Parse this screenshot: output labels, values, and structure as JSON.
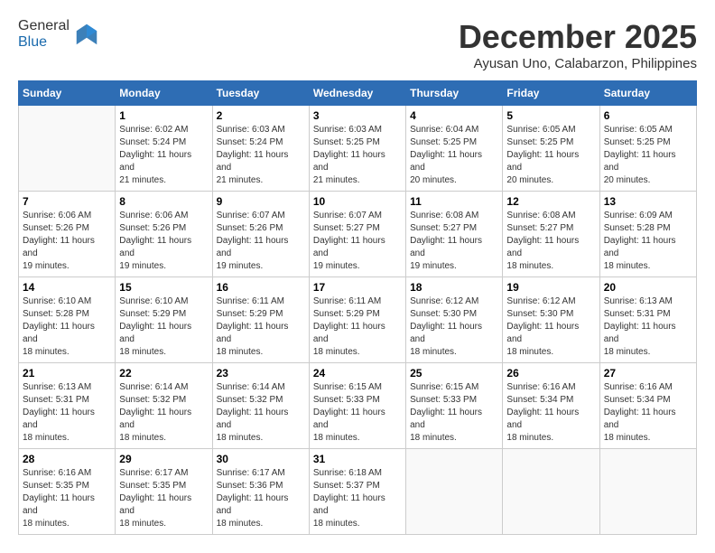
{
  "logo": {
    "general": "General",
    "blue": "Blue"
  },
  "header": {
    "month": "December 2025",
    "location": "Ayusan Uno, Calabarzon, Philippines"
  },
  "weekdays": [
    "Sunday",
    "Monday",
    "Tuesday",
    "Wednesday",
    "Thursday",
    "Friday",
    "Saturday"
  ],
  "weeks": [
    [
      {
        "day": "",
        "empty": true
      },
      {
        "day": "1",
        "sunrise": "6:02 AM",
        "sunset": "5:24 PM",
        "daylight": "11 hours and 21 minutes."
      },
      {
        "day": "2",
        "sunrise": "6:03 AM",
        "sunset": "5:24 PM",
        "daylight": "11 hours and 21 minutes."
      },
      {
        "day": "3",
        "sunrise": "6:03 AM",
        "sunset": "5:25 PM",
        "daylight": "11 hours and 21 minutes."
      },
      {
        "day": "4",
        "sunrise": "6:04 AM",
        "sunset": "5:25 PM",
        "daylight": "11 hours and 20 minutes."
      },
      {
        "day": "5",
        "sunrise": "6:05 AM",
        "sunset": "5:25 PM",
        "daylight": "11 hours and 20 minutes."
      },
      {
        "day": "6",
        "sunrise": "6:05 AM",
        "sunset": "5:25 PM",
        "daylight": "11 hours and 20 minutes."
      }
    ],
    [
      {
        "day": "7",
        "sunrise": "6:06 AM",
        "sunset": "5:26 PM",
        "daylight": "11 hours and 19 minutes."
      },
      {
        "day": "8",
        "sunrise": "6:06 AM",
        "sunset": "5:26 PM",
        "daylight": "11 hours and 19 minutes."
      },
      {
        "day": "9",
        "sunrise": "6:07 AM",
        "sunset": "5:26 PM",
        "daylight": "11 hours and 19 minutes."
      },
      {
        "day": "10",
        "sunrise": "6:07 AM",
        "sunset": "5:27 PM",
        "daylight": "11 hours and 19 minutes."
      },
      {
        "day": "11",
        "sunrise": "6:08 AM",
        "sunset": "5:27 PM",
        "daylight": "11 hours and 19 minutes."
      },
      {
        "day": "12",
        "sunrise": "6:08 AM",
        "sunset": "5:27 PM",
        "daylight": "11 hours and 18 minutes."
      },
      {
        "day": "13",
        "sunrise": "6:09 AM",
        "sunset": "5:28 PM",
        "daylight": "11 hours and 18 minutes."
      }
    ],
    [
      {
        "day": "14",
        "sunrise": "6:10 AM",
        "sunset": "5:28 PM",
        "daylight": "11 hours and 18 minutes."
      },
      {
        "day": "15",
        "sunrise": "6:10 AM",
        "sunset": "5:29 PM",
        "daylight": "11 hours and 18 minutes."
      },
      {
        "day": "16",
        "sunrise": "6:11 AM",
        "sunset": "5:29 PM",
        "daylight": "11 hours and 18 minutes."
      },
      {
        "day": "17",
        "sunrise": "6:11 AM",
        "sunset": "5:29 PM",
        "daylight": "11 hours and 18 minutes."
      },
      {
        "day": "18",
        "sunrise": "6:12 AM",
        "sunset": "5:30 PM",
        "daylight": "11 hours and 18 minutes."
      },
      {
        "day": "19",
        "sunrise": "6:12 AM",
        "sunset": "5:30 PM",
        "daylight": "11 hours and 18 minutes."
      },
      {
        "day": "20",
        "sunrise": "6:13 AM",
        "sunset": "5:31 PM",
        "daylight": "11 hours and 18 minutes."
      }
    ],
    [
      {
        "day": "21",
        "sunrise": "6:13 AM",
        "sunset": "5:31 PM",
        "daylight": "11 hours and 18 minutes."
      },
      {
        "day": "22",
        "sunrise": "6:14 AM",
        "sunset": "5:32 PM",
        "daylight": "11 hours and 18 minutes."
      },
      {
        "day": "23",
        "sunrise": "6:14 AM",
        "sunset": "5:32 PM",
        "daylight": "11 hours and 18 minutes."
      },
      {
        "day": "24",
        "sunrise": "6:15 AM",
        "sunset": "5:33 PM",
        "daylight": "11 hours and 18 minutes."
      },
      {
        "day": "25",
        "sunrise": "6:15 AM",
        "sunset": "5:33 PM",
        "daylight": "11 hours and 18 minutes."
      },
      {
        "day": "26",
        "sunrise": "6:16 AM",
        "sunset": "5:34 PM",
        "daylight": "11 hours and 18 minutes."
      },
      {
        "day": "27",
        "sunrise": "6:16 AM",
        "sunset": "5:34 PM",
        "daylight": "11 hours and 18 minutes."
      }
    ],
    [
      {
        "day": "28",
        "sunrise": "6:16 AM",
        "sunset": "5:35 PM",
        "daylight": "11 hours and 18 minutes."
      },
      {
        "day": "29",
        "sunrise": "6:17 AM",
        "sunset": "5:35 PM",
        "daylight": "11 hours and 18 minutes."
      },
      {
        "day": "30",
        "sunrise": "6:17 AM",
        "sunset": "5:36 PM",
        "daylight": "11 hours and 18 minutes."
      },
      {
        "day": "31",
        "sunrise": "6:18 AM",
        "sunset": "5:37 PM",
        "daylight": "11 hours and 18 minutes."
      },
      {
        "day": "",
        "empty": true
      },
      {
        "day": "",
        "empty": true
      },
      {
        "day": "",
        "empty": true
      }
    ]
  ]
}
